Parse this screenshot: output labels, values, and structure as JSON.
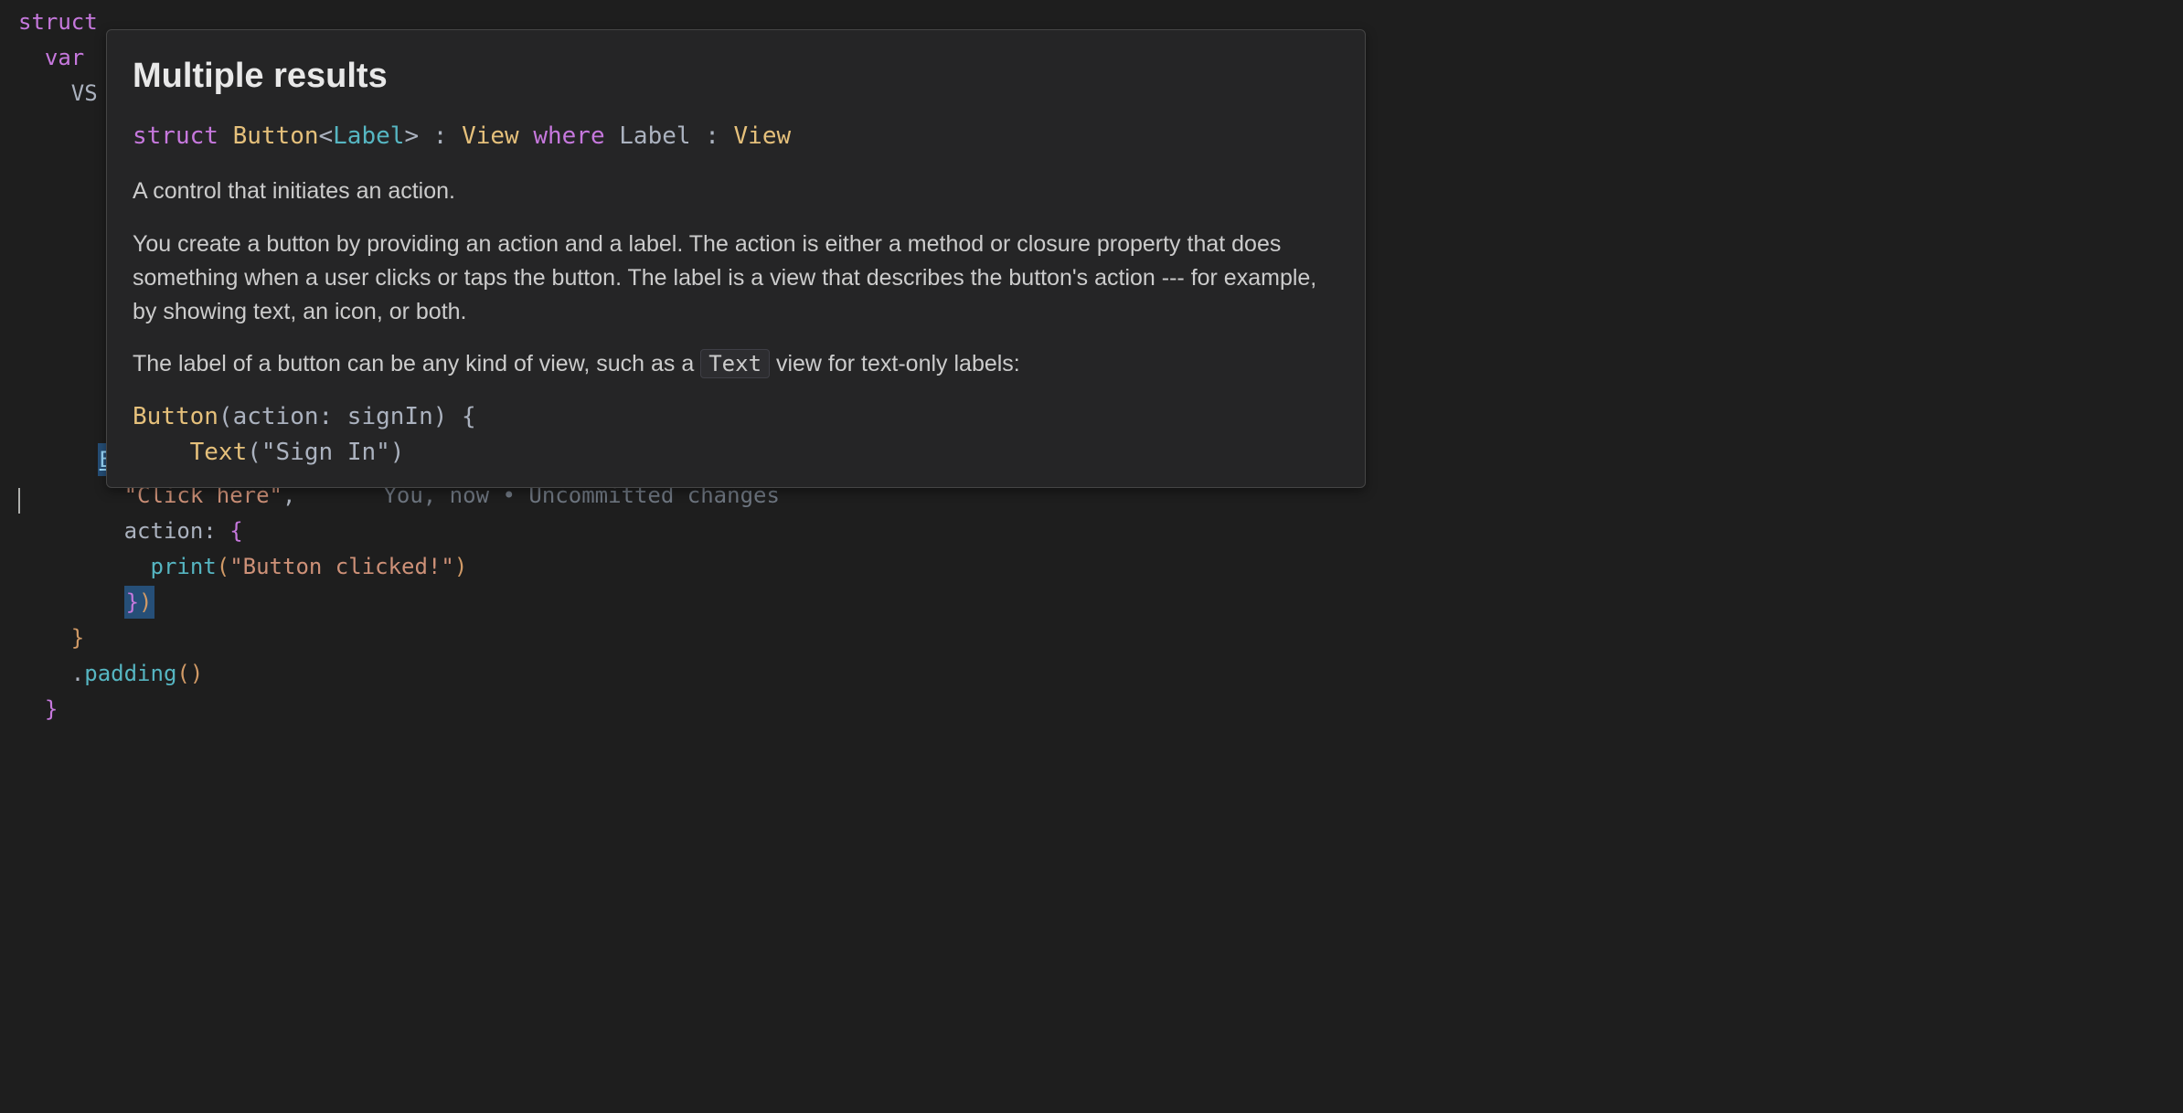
{
  "editor": {
    "line_struct": "struct",
    "line_var_keyword": "var",
    "line_vs": "VS",
    "button_token": "Button",
    "paren_open": "(",
    "click_here_string": "\"Click here\"",
    "comma": ",",
    "action_label": "action",
    "colon": ":",
    "brace_open": "{",
    "print_func": "print",
    "print_string": "\"Button clicked!\"",
    "brace_close_paren": "})",
    "brace_close": "}",
    "padding_dot": ".",
    "padding_method": "padding",
    "padding_parens": "()",
    "final_brace": "}"
  },
  "blame": {
    "author": "You, now",
    "separator": "•",
    "message": "Uncommitted changes"
  },
  "popup": {
    "title": "Multiple results",
    "signature": {
      "struct_kw": "struct",
      "button_type": "Button",
      "open_angle": "<",
      "label_gen": "Label",
      "close_angle": ">",
      "colon_space": " : ",
      "view_type": "View",
      "where_kw": "where",
      "label_name": "Label",
      "view_constraint": "View"
    },
    "summary": "A control that initiates an action.",
    "description": "You create a button by providing an action and a label. The action is either a method or closure property that does something when a user clicks or taps the button. The label is a view that describes the button's action --- for example, by showing text, an icon, or both.",
    "label_para_pre": "The label of a button can be any kind of view, such as a ",
    "label_para_code": "Text",
    "label_para_post": " view for text-only labels:",
    "code_example": {
      "line1_button": "Button",
      "line1_rest": "(action: signIn) {",
      "line2_text": "Text",
      "line2_rest": "(\"Sign In\")"
    }
  }
}
